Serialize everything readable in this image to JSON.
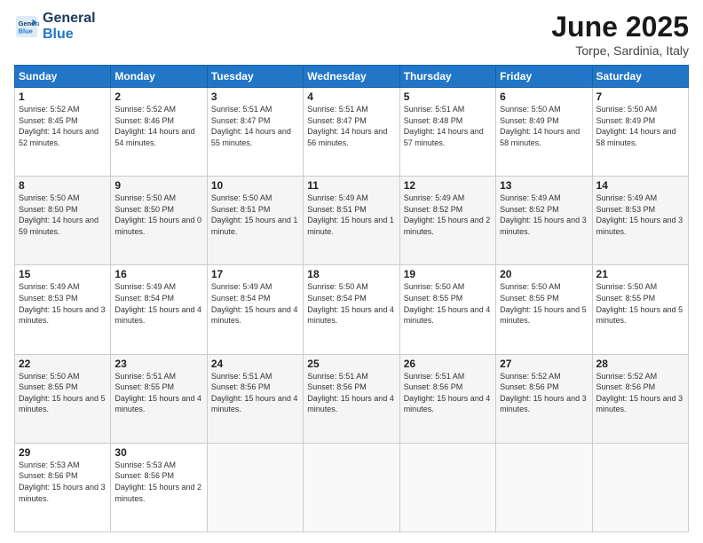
{
  "logo": {
    "line1": "General",
    "line2": "Blue"
  },
  "header": {
    "title": "June 2025",
    "subtitle": "Torpe, Sardinia, Italy"
  },
  "weekdays": [
    "Sunday",
    "Monday",
    "Tuesday",
    "Wednesday",
    "Thursday",
    "Friday",
    "Saturday"
  ],
  "weeks": [
    [
      {
        "day": "1",
        "sunrise": "5:52 AM",
        "sunset": "8:45 PM",
        "daylight": "14 hours and 52 minutes."
      },
      {
        "day": "2",
        "sunrise": "5:52 AM",
        "sunset": "8:46 PM",
        "daylight": "14 hours and 54 minutes."
      },
      {
        "day": "3",
        "sunrise": "5:51 AM",
        "sunset": "8:47 PM",
        "daylight": "14 hours and 55 minutes."
      },
      {
        "day": "4",
        "sunrise": "5:51 AM",
        "sunset": "8:47 PM",
        "daylight": "14 hours and 56 minutes."
      },
      {
        "day": "5",
        "sunrise": "5:51 AM",
        "sunset": "8:48 PM",
        "daylight": "14 hours and 57 minutes."
      },
      {
        "day": "6",
        "sunrise": "5:50 AM",
        "sunset": "8:49 PM",
        "daylight": "14 hours and 58 minutes."
      },
      {
        "day": "7",
        "sunrise": "5:50 AM",
        "sunset": "8:49 PM",
        "daylight": "14 hours and 58 minutes."
      }
    ],
    [
      {
        "day": "8",
        "sunrise": "5:50 AM",
        "sunset": "8:50 PM",
        "daylight": "14 hours and 59 minutes."
      },
      {
        "day": "9",
        "sunrise": "5:50 AM",
        "sunset": "8:50 PM",
        "daylight": "15 hours and 0 minutes."
      },
      {
        "day": "10",
        "sunrise": "5:50 AM",
        "sunset": "8:51 PM",
        "daylight": "15 hours and 1 minute."
      },
      {
        "day": "11",
        "sunrise": "5:49 AM",
        "sunset": "8:51 PM",
        "daylight": "15 hours and 1 minute."
      },
      {
        "day": "12",
        "sunrise": "5:49 AM",
        "sunset": "8:52 PM",
        "daylight": "15 hours and 2 minutes."
      },
      {
        "day": "13",
        "sunrise": "5:49 AM",
        "sunset": "8:52 PM",
        "daylight": "15 hours and 3 minutes."
      },
      {
        "day": "14",
        "sunrise": "5:49 AM",
        "sunset": "8:53 PM",
        "daylight": "15 hours and 3 minutes."
      }
    ],
    [
      {
        "day": "15",
        "sunrise": "5:49 AM",
        "sunset": "8:53 PM",
        "daylight": "15 hours and 3 minutes."
      },
      {
        "day": "16",
        "sunrise": "5:49 AM",
        "sunset": "8:54 PM",
        "daylight": "15 hours and 4 minutes."
      },
      {
        "day": "17",
        "sunrise": "5:49 AM",
        "sunset": "8:54 PM",
        "daylight": "15 hours and 4 minutes."
      },
      {
        "day": "18",
        "sunrise": "5:50 AM",
        "sunset": "8:54 PM",
        "daylight": "15 hours and 4 minutes."
      },
      {
        "day": "19",
        "sunrise": "5:50 AM",
        "sunset": "8:55 PM",
        "daylight": "15 hours and 4 minutes."
      },
      {
        "day": "20",
        "sunrise": "5:50 AM",
        "sunset": "8:55 PM",
        "daylight": "15 hours and 5 minutes."
      },
      {
        "day": "21",
        "sunrise": "5:50 AM",
        "sunset": "8:55 PM",
        "daylight": "15 hours and 5 minutes."
      }
    ],
    [
      {
        "day": "22",
        "sunrise": "5:50 AM",
        "sunset": "8:55 PM",
        "daylight": "15 hours and 5 minutes."
      },
      {
        "day": "23",
        "sunrise": "5:51 AM",
        "sunset": "8:55 PM",
        "daylight": "15 hours and 4 minutes."
      },
      {
        "day": "24",
        "sunrise": "5:51 AM",
        "sunset": "8:56 PM",
        "daylight": "15 hours and 4 minutes."
      },
      {
        "day": "25",
        "sunrise": "5:51 AM",
        "sunset": "8:56 PM",
        "daylight": "15 hours and 4 minutes."
      },
      {
        "day": "26",
        "sunrise": "5:51 AM",
        "sunset": "8:56 PM",
        "daylight": "15 hours and 4 minutes."
      },
      {
        "day": "27",
        "sunrise": "5:52 AM",
        "sunset": "8:56 PM",
        "daylight": "15 hours and 3 minutes."
      },
      {
        "day": "28",
        "sunrise": "5:52 AM",
        "sunset": "8:56 PM",
        "daylight": "15 hours and 3 minutes."
      }
    ],
    [
      {
        "day": "29",
        "sunrise": "5:53 AM",
        "sunset": "8:56 PM",
        "daylight": "15 hours and 3 minutes."
      },
      {
        "day": "30",
        "sunrise": "5:53 AM",
        "sunset": "8:56 PM",
        "daylight": "15 hours and 2 minutes."
      },
      null,
      null,
      null,
      null,
      null
    ]
  ]
}
